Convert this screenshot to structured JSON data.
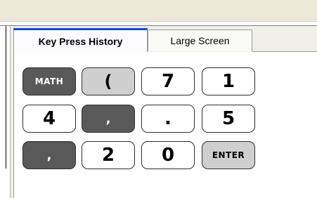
{
  "tabs": [
    {
      "label": "Key Press History",
      "active": true
    },
    {
      "label": "Large Screen",
      "active": false
    }
  ],
  "keys": [
    {
      "label": "MATH",
      "style": "dark"
    },
    {
      "label": "(",
      "style": "light-gray"
    },
    {
      "label": "7",
      "style": "white"
    },
    {
      "label": "1",
      "style": "white"
    },
    {
      "label": "4",
      "style": "white"
    },
    {
      "label": ",",
      "style": "dark"
    },
    {
      "label": ".",
      "style": "white"
    },
    {
      "label": "5",
      "style": "white"
    },
    {
      "label": ",",
      "style": "dark"
    },
    {
      "label": "2",
      "style": "white"
    },
    {
      "label": "0",
      "style": "white"
    },
    {
      "label": "ENTER",
      "style": "light-gray"
    }
  ],
  "colors": {
    "active_tab_accent": "#0a46ff",
    "dark_key": "#595959",
    "light_key": "#cfcfcf"
  }
}
